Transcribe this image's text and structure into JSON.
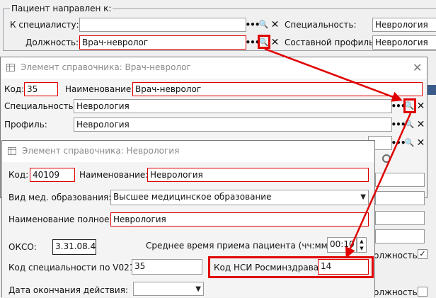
{
  "referral_group": {
    "legend": "Пациент направлен к:",
    "to_specialist_label": "К специалисту:",
    "to_specialist_value": "",
    "position_label": "Должность:",
    "position_value": "Врач-невролог",
    "specialty_label": "Специальность:",
    "specialty_value": "Неврология",
    "composite_profile_label": "Составной профиль:",
    "composite_profile_value": "Неврология"
  },
  "dialog1": {
    "title": "Элемент справочника: Врач-невролог",
    "code_label": "Код:",
    "code_value": "35",
    "name_label": "Наименование:",
    "name_value": "Врач-невролог",
    "specialty_label": "Специальность:",
    "specialty_value": "Неврология",
    "profile_label": "Профиль:",
    "profile_value": "Неврология"
  },
  "dialog2": {
    "title": "Элемент справочника: Неврология",
    "code_label": "Код:",
    "code_value": "40109",
    "name_label": "Наименование:",
    "name_value": "Неврология",
    "education_label": "Вид мед. образования:",
    "education_value": "Высшее медицинское образование",
    "full_name_label": "Наименование полное:",
    "full_name_value": "Неврология",
    "okso_label": "ОКСО:",
    "okso_value": "3.31.08.4",
    "avg_time_label": "Среднее время приема пациента (чч:мм):",
    "avg_time_value": "00:10",
    "v021_label": "Код специальности по V021:",
    "v021_value": "35",
    "nsi_label": "Код НСИ Росминздрава:",
    "nsi_value": "14",
    "end_date_label": "Дата окончания действия:",
    "end_date_value": ""
  },
  "background_fragments": {
    "checkbox_label_1": "олжность",
    "checkbox_label_2": "олжность"
  },
  "icons": {
    "dots": "•••",
    "search": "🔍",
    "clear": "✕",
    "close": "✕",
    "dropdown": "▼",
    "spin_up": "▲",
    "spin_down": "▼",
    "check": "✓"
  },
  "colors": {
    "highlight": "#e00000",
    "required_border": "#d00000"
  }
}
